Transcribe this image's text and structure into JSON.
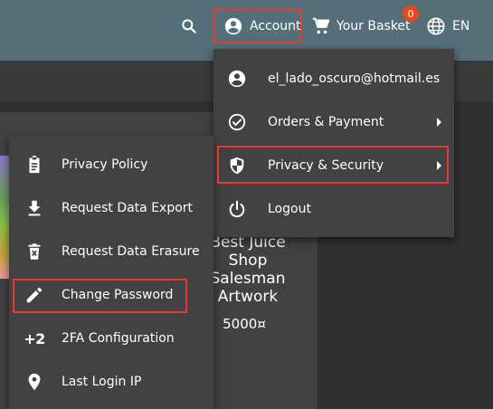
{
  "toolbar": {
    "search_icon": "search-icon",
    "account_label": "Account",
    "basket_label": "Your Basket",
    "basket_count": "0",
    "language_label": "EN"
  },
  "product_card": {
    "title": "Best Juice Shop Salesman Artwork",
    "price": "5000¤"
  },
  "account_menu": {
    "items": [
      {
        "label": "el_lado_oscuro@hotmail.es",
        "icon": "account-circle-icon"
      },
      {
        "label": "Orders & Payment",
        "icon": "check-circle-icon",
        "submenu": true
      },
      {
        "label": "Privacy & Security",
        "icon": "security-shield-icon",
        "submenu": true
      },
      {
        "label": "Logout",
        "icon": "power-icon"
      }
    ]
  },
  "privacy_menu": {
    "items": [
      {
        "label": "Privacy Policy",
        "icon": "clipboard-icon"
      },
      {
        "label": "Request Data Export",
        "icon": "download-icon"
      },
      {
        "label": "Request Data Erasure",
        "icon": "delete-icon"
      },
      {
        "label": "Change Password",
        "icon": "pencil-icon"
      },
      {
        "label": "2FA Configuration",
        "icon": "plus-two-icon",
        "icon_text": "+2"
      },
      {
        "label": "Last Login IP",
        "icon": "location-pin-icon"
      }
    ]
  },
  "colors": {
    "toolbar": "#546e7a",
    "menu": "#424242",
    "highlight": "#e53935",
    "badge": "#e64a19"
  }
}
